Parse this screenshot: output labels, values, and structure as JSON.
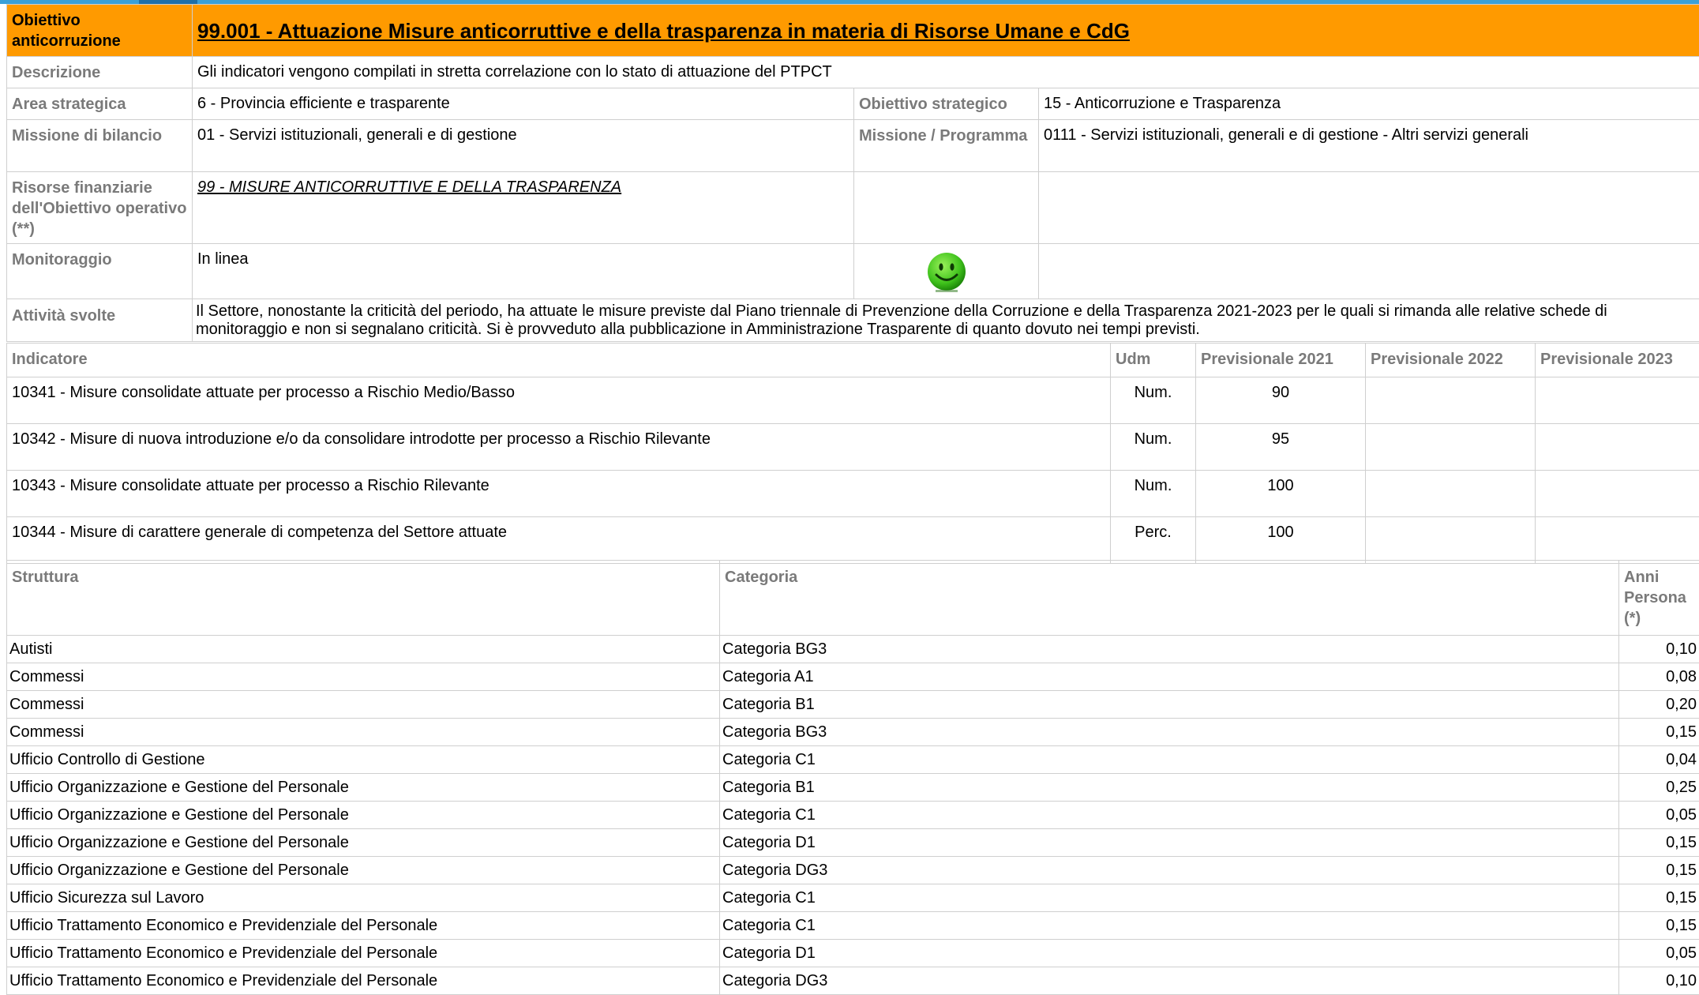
{
  "header": {
    "label": "Obiettivo anticorruzione",
    "title": "99.001 - Attuazione Misure anticorruttive e della trasparenza in materia di Risorse Umane e CdG"
  },
  "descrizione": {
    "label": "Descrizione",
    "value": "Gli indicatori vengono compilati in stretta correlazione con lo stato di attuazione del PTPCT"
  },
  "area_strategica": {
    "label": "Area strategica",
    "value": "6 - Provincia efficiente e trasparente"
  },
  "obiettivo_strategico": {
    "label": "Obiettivo strategico",
    "value": "15 - Anticorruzione e Trasparenza"
  },
  "missione_bilancio": {
    "label": "Missione di bilancio",
    "value": "01 - Servizi istituzionali, generali e di gestione"
  },
  "missione_programma": {
    "label": "Missione / Programma",
    "value": "0111 - Servizi istituzionali, generali e di gestione - Altri servizi generali"
  },
  "risorse": {
    "label": "Risorse finanziarie dell'Obiettivo operativo (**)",
    "value": "99 - MISURE ANTICORRUTTIVE E DELLA TRASPARENZA"
  },
  "monitoraggio": {
    "label": "Monitoraggio",
    "value": "In linea",
    "status_icon": "smiley-green-icon",
    "status_color": "#3fc21c"
  },
  "attivita": {
    "label": "Attività svolte",
    "value": "Il Settore, nonostante la criticità del periodo, ha attuate le misure previste dal Piano triennale di Prevenzione della Corruzione e della Trasparenza 2021-2023 per le quali si rimanda alle relative schede di monitoraggio e non si segnalano criticità. Si è provveduto alla pubblicazione in Amministrazione Trasparente di quanto dovuto nei tempi previsti."
  },
  "indicatori": {
    "headers": {
      "indicatore": "Indicatore",
      "udm": "Udm",
      "p2021": "Previsionale 2021",
      "p2022": "Previsionale 2022",
      "p2023": "Previsionale 2023"
    },
    "rows": [
      {
        "name": "10341 - Misure consolidate attuate per processo a Rischio Medio/Basso",
        "udm": "Num.",
        "p2021": "90",
        "p2022": "",
        "p2023": ""
      },
      {
        "name": "10342 - Misure di nuova introduzione e/o da consolidare introdotte per processo a Rischio Rilevante",
        "udm": "Num.",
        "p2021": "95",
        "p2022": "",
        "p2023": ""
      },
      {
        "name": "10343 - Misure consolidate attuate per processo a Rischio Rilevante",
        "udm": "Num.",
        "p2021": "100",
        "p2022": "",
        "p2023": ""
      },
      {
        "name": "10344 - Misure di carattere generale di competenza del Settore attuate",
        "udm": "Perc.",
        "p2021": "100",
        "p2022": "",
        "p2023": ""
      }
    ]
  },
  "risorse_umane": {
    "headers": {
      "struttura": "Struttura",
      "categoria": "Categoria",
      "anni": "Anni Persona (*)"
    },
    "rows": [
      {
        "struttura": "Autisti",
        "categoria": "Categoria BG3",
        "anni": "0,10"
      },
      {
        "struttura": "Commessi",
        "categoria": "Categoria A1",
        "anni": "0,08"
      },
      {
        "struttura": "Commessi",
        "categoria": "Categoria B1",
        "anni": "0,20"
      },
      {
        "struttura": "Commessi",
        "categoria": "Categoria BG3",
        "anni": "0,15"
      },
      {
        "struttura": "Ufficio Controllo di Gestione",
        "categoria": "Categoria C1",
        "anni": "0,04"
      },
      {
        "struttura": "Ufficio Organizzazione e Gestione del Personale",
        "categoria": "Categoria B1",
        "anni": "0,25"
      },
      {
        "struttura": "Ufficio Organizzazione e Gestione del Personale",
        "categoria": "Categoria C1",
        "anni": "0,05"
      },
      {
        "struttura": "Ufficio Organizzazione e Gestione del Personale",
        "categoria": "Categoria D1",
        "anni": "0,15"
      },
      {
        "struttura": "Ufficio Organizzazione e Gestione del Personale",
        "categoria": "Categoria DG3",
        "anni": "0,15"
      },
      {
        "struttura": "Ufficio Sicurezza sul Lavoro",
        "categoria": "Categoria C1",
        "anni": "0,15"
      },
      {
        "struttura": "Ufficio Trattamento Economico e Previdenziale del Personale",
        "categoria": "Categoria C1",
        "anni": "0,15"
      },
      {
        "struttura": "Ufficio Trattamento Economico e Previdenziale del Personale",
        "categoria": "Categoria D1",
        "anni": "0,05"
      },
      {
        "struttura": "Ufficio Trattamento Economico e Previdenziale del Personale",
        "categoria": "Categoria DG3",
        "anni": "0,10"
      }
    ]
  }
}
